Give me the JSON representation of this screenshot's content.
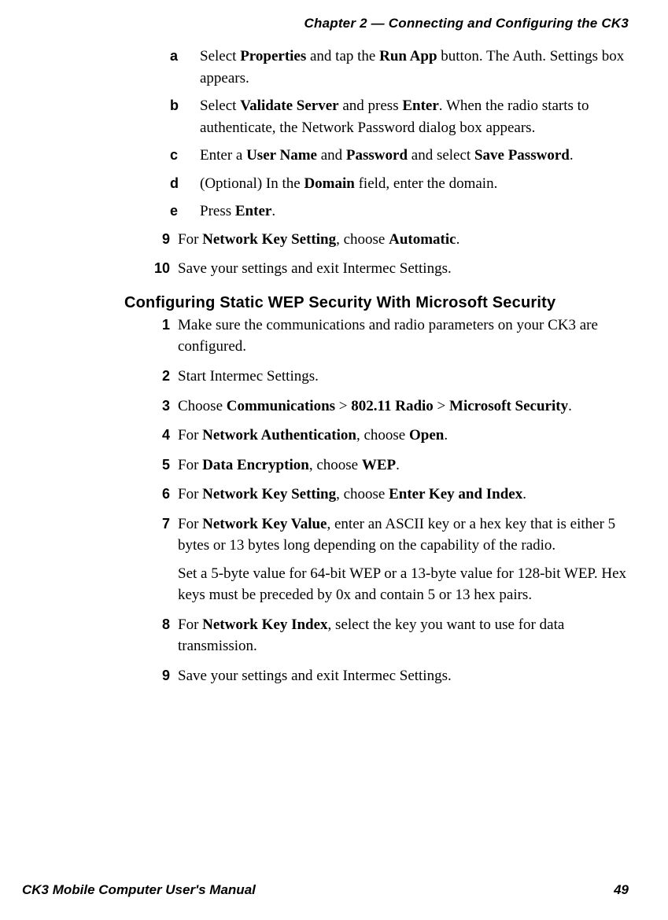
{
  "header": {
    "chapter": "Chapter 2 — Connecting and Configuring the CK3"
  },
  "substeps": {
    "a": {
      "marker": "a",
      "html": "Select <b>Properties</b> and tap the <b>Run App</b> button. The Auth. Settings box appears."
    },
    "b": {
      "marker": "b",
      "html": "Select <b>Validate Server</b> and press <b>Enter</b>. When the radio starts to authenticate, the Network Password dialog box appears."
    },
    "c": {
      "marker": "c",
      "html": "Enter a <b>User Name</b> and <b>Password</b> and select <b>Save Password</b>."
    },
    "d": {
      "marker": "d",
      "html": "(Optional) In the <b>Domain</b> field, enter the domain."
    },
    "e": {
      "marker": "e",
      "html": "Press <b>Enter</b>."
    }
  },
  "steps_top": {
    "s9": {
      "marker": "9",
      "html": "For <b>Network Key Setting</b>, choose <b>Automatic</b>."
    },
    "s10": {
      "marker": "10",
      "html": "Save your settings and exit Intermec Settings."
    }
  },
  "section_heading": "Configuring Static WEP Security With Microsoft Security",
  "steps_wep": {
    "s1": {
      "marker": "1",
      "html": "Make sure the communications and radio parameters on your CK3 are configured."
    },
    "s2": {
      "marker": "2",
      "html": "Start Intermec Settings."
    },
    "s3": {
      "marker": "3",
      "html": "Choose <b>Communications</b> > <b>802.11 Radio</b> > <b>Microsoft Security</b>."
    },
    "s4": {
      "marker": "4",
      "html": "For <b>Network Authentication</b>, choose <b>Open</b>."
    },
    "s5": {
      "marker": "5",
      "html": "For <b>Data Encryption</b>, choose <b>WEP</b>."
    },
    "s6": {
      "marker": "6",
      "html": "For <b>Network Key Setting</b>, choose <b>Enter Key and Index</b>."
    },
    "s7": {
      "marker": "7",
      "html": "For <b>Network Key Value</b>, enter an ASCII key or a hex key that is either 5 bytes or 13 bytes long depending on the capability of the radio."
    },
    "s7_extra": "Set a 5-byte value for 64-bit WEP or a 13-byte value for 128-bit WEP. Hex keys must be preceded by 0x and contain 5 or 13 hex pairs.",
    "s8": {
      "marker": "8",
      "html": "For <b>Network Key Index</b>, select the key you want to use for data transmission."
    },
    "s9": {
      "marker": "9",
      "html": "Save your settings and exit Intermec Settings."
    }
  },
  "footer": {
    "manual": "CK3 Mobile Computer User's Manual",
    "page": "49"
  }
}
